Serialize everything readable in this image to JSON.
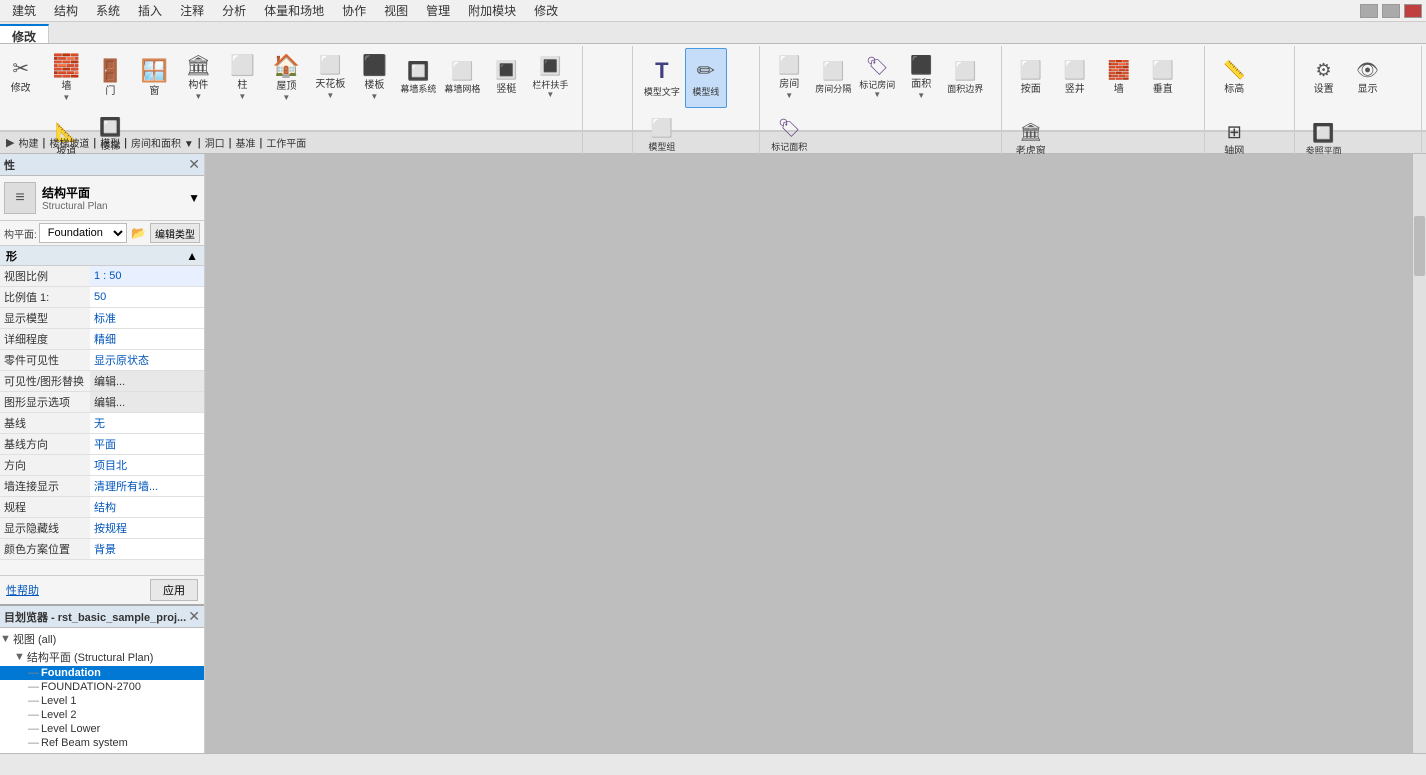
{
  "menubar": {
    "items": [
      "建筑",
      "结构",
      "系统",
      "插入",
      "注释",
      "分析",
      "体量和场地",
      "协作",
      "视图",
      "管理",
      "附加模块",
      "修改"
    ]
  },
  "ribbon": {
    "active_tab": "修改",
    "groups": [
      {
        "label": "构建",
        "buttons": [
          {
            "icon": "🧱",
            "label": "墙",
            "class": "icon-wall"
          },
          {
            "icon": "🚪",
            "label": "门",
            "class": "icon-door"
          },
          {
            "icon": "🪟",
            "label": "窗",
            "class": "icon-window"
          },
          {
            "icon": "🏛",
            "label": "构件",
            "class": ""
          },
          {
            "icon": "⬜",
            "label": "柱",
            "class": ""
          },
          {
            "icon": "🏠",
            "label": "屋顶",
            "class": "icon-roof"
          },
          {
            "icon": "⬜",
            "label": "天花板",
            "class": "icon-ceiling"
          },
          {
            "icon": "⬛",
            "label": "楼板",
            "class": ""
          },
          {
            "icon": "🔲",
            "label": "幕墙系统",
            "class": ""
          },
          {
            "icon": "⬜",
            "label": "幕墙网格",
            "class": ""
          },
          {
            "icon": "🔳",
            "label": "竖梃",
            "class": ""
          },
          {
            "icon": "🔳",
            "label": "栏杆扶手",
            "class": ""
          },
          {
            "icon": "📐",
            "label": "坡道",
            "class": ""
          },
          {
            "icon": "🔲",
            "label": "楼梯",
            "class": ""
          }
        ]
      },
      {
        "label": "楼梯坡道",
        "buttons": []
      },
      {
        "label": "模型",
        "buttons": [
          {
            "icon": "T",
            "label": "模型文字",
            "class": ""
          },
          {
            "icon": "✏",
            "label": "模型线",
            "class": "icon-model-line",
            "active": true
          },
          {
            "icon": "⬜",
            "label": "模型组",
            "class": ""
          }
        ]
      },
      {
        "label": "房间和面积",
        "buttons": [
          {
            "icon": "⬜",
            "label": "房间",
            "class": ""
          },
          {
            "icon": "⬜",
            "label": "房间分隔",
            "class": ""
          },
          {
            "icon": "🏷",
            "label": "标记房间",
            "class": ""
          },
          {
            "icon": "⬛",
            "label": "面积",
            "class": ""
          },
          {
            "icon": "⬜",
            "label": "面积边界",
            "class": ""
          },
          {
            "icon": "🏷",
            "label": "标记面积",
            "class": ""
          }
        ]
      },
      {
        "label": "洞口",
        "buttons": [
          {
            "icon": "⬜",
            "label": "按面",
            "class": ""
          },
          {
            "icon": "⬜",
            "label": "竖井",
            "class": ""
          },
          {
            "icon": "🧱",
            "label": "墙",
            "class": ""
          },
          {
            "icon": "⬜",
            "label": "垂直",
            "class": ""
          },
          {
            "icon": "🏛",
            "label": "老虎窗",
            "class": ""
          }
        ]
      },
      {
        "label": "基准",
        "buttons": [
          {
            "icon": "📏",
            "label": "标高",
            "class": ""
          },
          {
            "icon": "⊞",
            "label": "轴网",
            "class": ""
          }
        ]
      },
      {
        "label": "工作平面",
        "buttons": [
          {
            "icon": "⚙",
            "label": "设置",
            "class": ""
          },
          {
            "icon": "👁",
            "label": "显示",
            "class": ""
          },
          {
            "icon": "🔲",
            "label": "参照平面",
            "class": ""
          }
        ]
      }
    ]
  },
  "properties_panel": {
    "title": "性",
    "type_icon": "≡",
    "type_name": "结构平面",
    "type_sub": "Structural Plan",
    "selector_value": "Foundation",
    "edit_type_label": "编辑类型",
    "section_title": "形",
    "table_rows": [
      {
        "label": "视图比例",
        "value": "1 : 50",
        "editable": true
      },
      {
        "label": "比例值 1:",
        "value": "50",
        "editable": false
      },
      {
        "label": "显示模型",
        "value": "标准",
        "editable": false
      },
      {
        "label": "详细程度",
        "value": "精细",
        "editable": false
      },
      {
        "label": "零件可见性",
        "value": "显示原状态",
        "editable": false
      },
      {
        "label": "可见性/图形替换",
        "value": "编辑...",
        "editable": false,
        "btn": true
      },
      {
        "label": "图形显示选项",
        "value": "编辑...",
        "editable": false,
        "btn": true
      },
      {
        "label": "基线",
        "value": "无",
        "editable": false
      },
      {
        "label": "基线方向",
        "value": "平面",
        "editable": false
      },
      {
        "label": "方向",
        "value": "项目北",
        "editable": false
      },
      {
        "label": "墙连接显示",
        "value": "清理所有墙...",
        "editable": false
      },
      {
        "label": "规程",
        "value": "结构",
        "editable": false
      },
      {
        "label": "显示隐藏线",
        "value": "按规程",
        "editable": false
      },
      {
        "label": "颜色方案位置",
        "value": "背景",
        "editable": false
      }
    ],
    "help_label": "性帮助",
    "apply_label": "应用"
  },
  "browser_panel": {
    "title": "目划览器 - rst_basic_sample_proj...",
    "tree": [
      {
        "level": 0,
        "icon": "📁",
        "label": "视图 (all)",
        "expanded": true,
        "type": "group"
      },
      {
        "level": 1,
        "icon": "📂",
        "label": "结构平面 (Structural Plan)",
        "expanded": true,
        "type": "group"
      },
      {
        "level": 2,
        "icon": "📄",
        "label": "Foundation",
        "expanded": false,
        "type": "view",
        "selected": true
      },
      {
        "level": 2,
        "icon": "📄",
        "label": "FOUNDATION-2700",
        "expanded": false,
        "type": "view"
      },
      {
        "level": 2,
        "icon": "📄",
        "label": "Level 1",
        "expanded": false,
        "type": "view"
      },
      {
        "level": 2,
        "icon": "📄",
        "label": "Level 2",
        "expanded": false,
        "type": "view"
      },
      {
        "level": 2,
        "icon": "📄",
        "label": "Level Lower",
        "expanded": false,
        "type": "view"
      },
      {
        "level": 2,
        "icon": "📄",
        "label": "Ref Beam system",
        "expanded": false,
        "type": "view"
      }
    ]
  },
  "canvas": {
    "background_color": "#c0c0c0"
  },
  "status_bar": {
    "text": ""
  }
}
